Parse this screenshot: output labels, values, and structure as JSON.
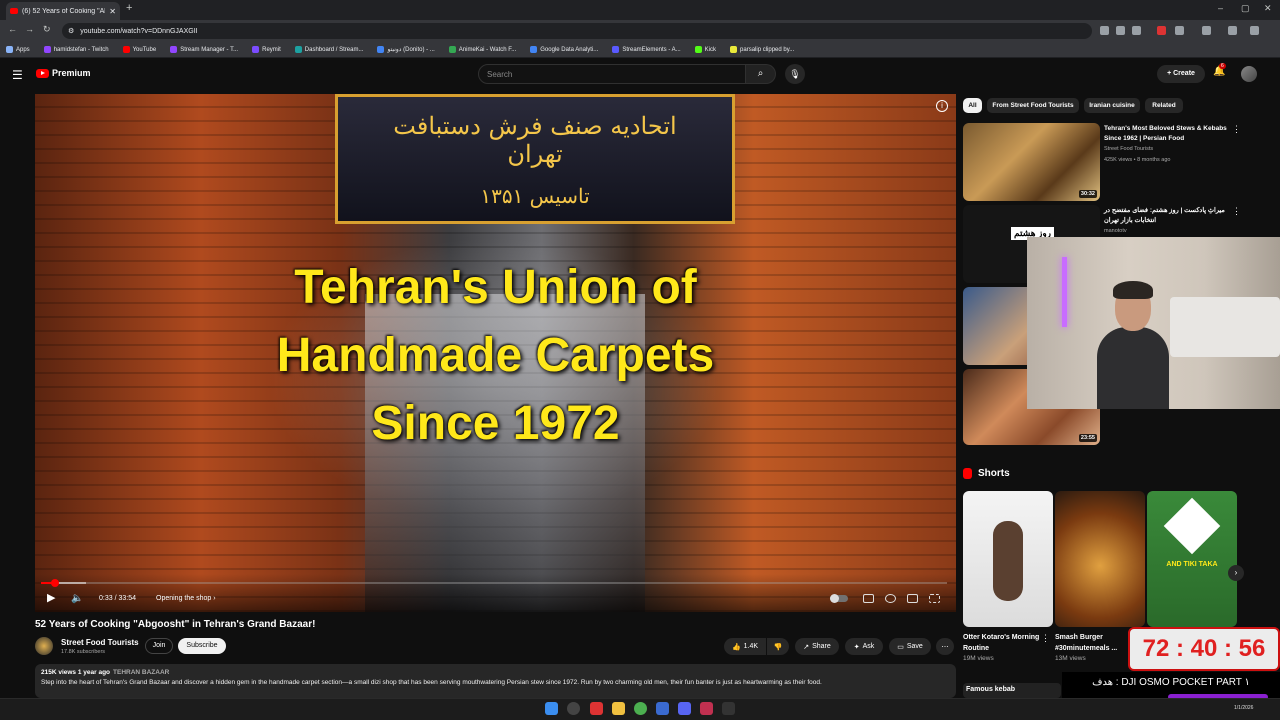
{
  "browser": {
    "tab_title": "(6) 52 Years of Cooking \"Ab",
    "url": "youtube.com/watch?v=DDnnGJAXGII",
    "bookmarks": [
      "Apps",
      "hamidstefan - Twitch",
      "YouTube",
      "Stream Manager - T...",
      "Reymit",
      "Dashboard / Stream...",
      "دونیتو (Donito) - ...",
      "AnimeKai - Watch F...",
      "Google Data Analyti...",
      "StreamElements - A...",
      "Kick",
      "parsalip clipped by..."
    ]
  },
  "header": {
    "logo_text": "Premium",
    "search_placeholder": "Search",
    "create_label": "Create",
    "notif_count": "6"
  },
  "video": {
    "overlay_line1": "Tehran's Union of",
    "overlay_line2": "Handmade Carpets",
    "overlay_line3": "Since 1972",
    "sign_text_1": "اتحادیه صنف فرش دستبافت تهران",
    "sign_text_2": "تاسیس ۱۳۵۱",
    "time": "0:33 / 33:54",
    "chapter": "Opening the shop",
    "played_fraction": 0.016,
    "loaded_fraction": 0.05
  },
  "meta": {
    "title": "52 Years of Cooking \"Abgoosht\" in Tehran's Grand Bazaar!",
    "channel": "Street Food Tourists",
    "subs": "17.8K subscribers",
    "join": "Join",
    "subscribe": "Subscribe",
    "likes": "1.4K",
    "share": "Share",
    "ask": "Ask",
    "save": "Save",
    "views_date": "215K views  1 year ago",
    "tag": "TEHRAN BAZAAR",
    "description": "Step into the heart of Tehran's Grand Bazaar and discover a hidden gem in the handmade carpet section—a small dizi shop that has been serving mouthwatering Persian stew since 1972. Run by two charming old men, their fun banter is just as heartwarming as their food."
  },
  "chips": [
    "All",
    "From Street Food Tourists",
    "Iranian cuisine",
    "Related"
  ],
  "recs": [
    {
      "title": "Tehran's Most Beloved Stews & Kebabs Since 1962 | Persian Food",
      "channel": "Street Food Tourists",
      "meta": "425K views • 8 months ago",
      "duration": "30:32"
    },
    {
      "title": "میراثِ پادکست | روز هشتم: فضای مفتضح در انتخابات بازار تهران",
      "channel": "manototv",
      "thumb_text": "روز هشتم",
      "duration": ""
    },
    {
      "title": "",
      "channel": "",
      "duration": "23:55"
    }
  ],
  "shorts": {
    "heading": "Shorts",
    "items": [
      {
        "title": "Otter Kotaro's Morning Routine",
        "views": "19M views"
      },
      {
        "title": "Smash Burger #30minutemeals ...",
        "views": "13M views"
      },
      {
        "title": "AND TIKI TAKA",
        "views": ""
      }
    ],
    "next_label": "Famous kebab"
  },
  "timer": {
    "value": "72 : 40 : 56",
    "goal": "هدف : DJI OSMO POCKET PART ۱"
  },
  "taskbar": {
    "clock": "1/1/2026"
  },
  "colors": {
    "accent": "#ff0000",
    "overlay_text": "#ffe81a",
    "background": "#0f0f0f"
  }
}
